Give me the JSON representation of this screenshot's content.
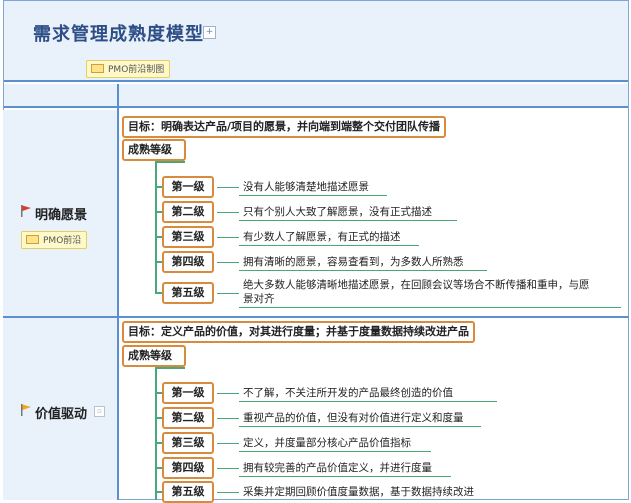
{
  "header": {
    "title": "需求管理成熟度模型",
    "tag": "PMO前沿制图"
  },
  "sections": [
    {
      "category": "明确愿景",
      "tag": "PMO前沿",
      "goal": "目标：明确表达产品/项目的愿景，并向端到端整个交付团队传播",
      "maturity": "成熟等级",
      "levels": [
        {
          "label": "第一级",
          "desc": "没有人能够清楚地描述愿景"
        },
        {
          "label": "第二级",
          "desc": "只有个别人大致了解愿景，没有正式描述"
        },
        {
          "label": "第三级",
          "desc": "有少数人了解愿景，有正式的描述"
        },
        {
          "label": "第四级",
          "desc": "拥有清晰的愿景，容易查看到，为多数人所熟悉"
        },
        {
          "label": "第五级",
          "desc_line1": "绝大多数人能够清晰地描述愿景，在回顾会议等场合不断传播和重申，与愿",
          "desc_line2": "景对齐"
        }
      ]
    },
    {
      "category": "价值驱动",
      "goal": "目标：定义产品的价值，对其进行度量；并基于度量数据持续改进产品",
      "maturity": "成熟等级",
      "levels": [
        {
          "label": "第一级",
          "desc": "不了解，不关注所开发的产品最终创造的价值"
        },
        {
          "label": "第二级",
          "desc": "重视产品的价值，但没有对价值进行定义和度量"
        },
        {
          "label": "第三级",
          "desc": "定义，并度量部分核心产品价值指标"
        },
        {
          "label": "第四级",
          "desc": "拥有较完善的产品价值定义，并进行度量"
        },
        {
          "label": "第五级",
          "desc": "采集并定期回顾价值度量数据，基于数据持续改进"
        }
      ]
    }
  ],
  "colors": {
    "header_bg": "#e9f1fb",
    "grid_line": "#5b8fcf",
    "title": "#2e4f86",
    "box_border": "#d88a3d",
    "connector": "#49a87a",
    "flag_red": "#e03a2f",
    "flag_orange": "#f2a51f"
  }
}
